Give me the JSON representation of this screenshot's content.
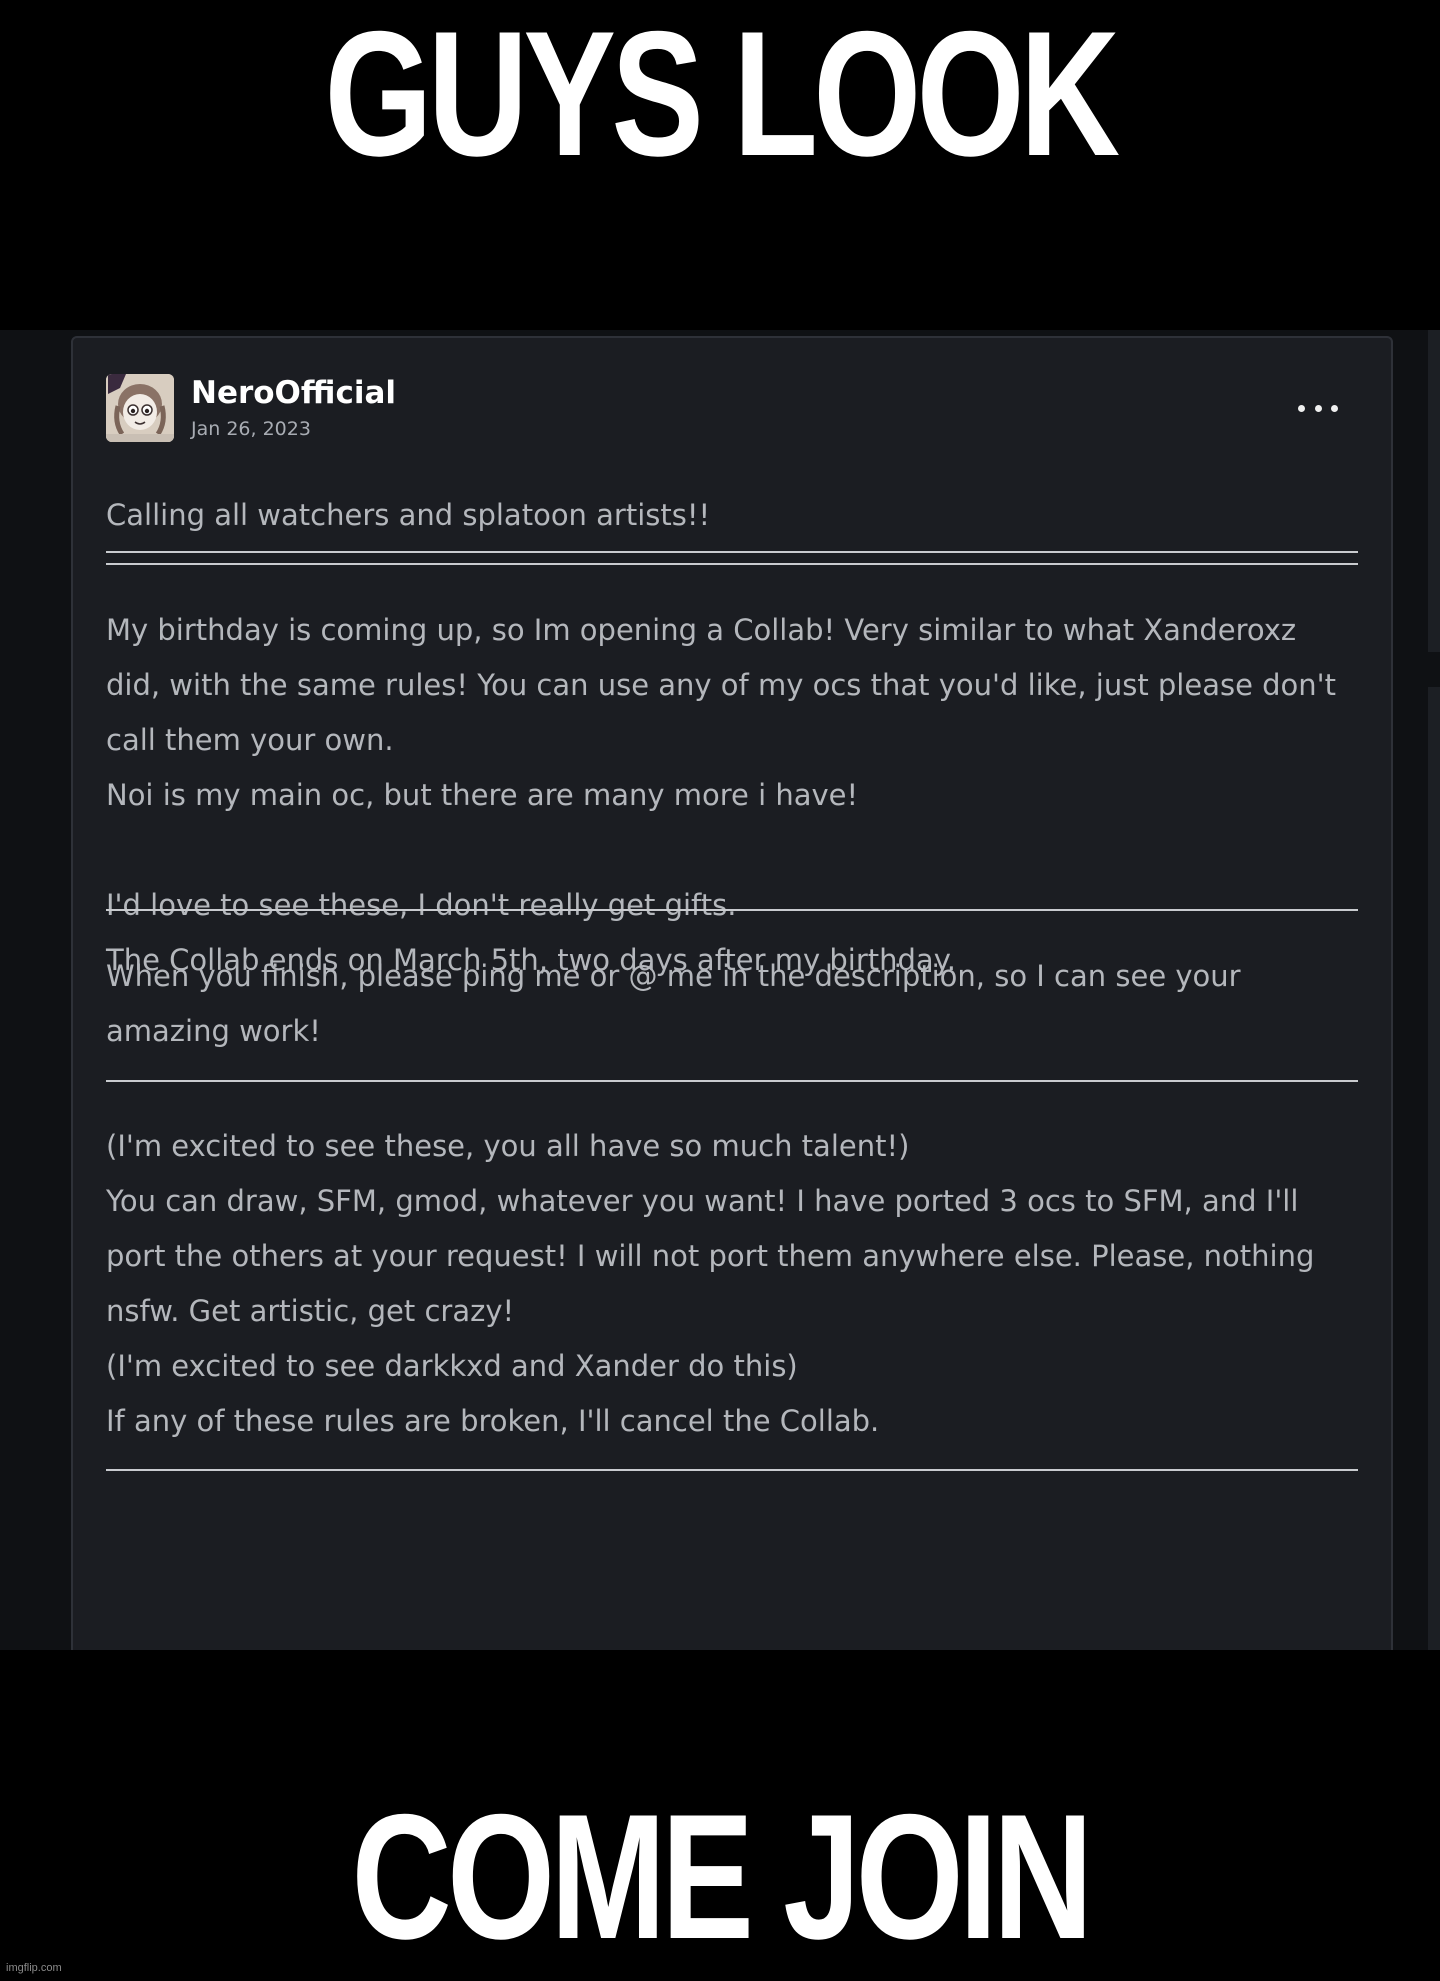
{
  "meme": {
    "top_caption": "GUYS LOOK",
    "bottom_caption": "COME JOIN",
    "watermark": "imgflip.com"
  },
  "post": {
    "author": "NeroOfficial",
    "date": "Jan 26, 2023",
    "avatar_icon": "avatar-image",
    "more_icon": "more-options-icon",
    "intro": "Calling all watchers and splatoon artists!!",
    "section_1": "My birthday is coming up, so Im opening a Collab! Very similar to what Xanderoxz did, with the same rules! You can use any of my ocs that you'd like, just please don't call them your own.\nNoi is my main oc, but there are many more i have!\n\nI'd love to see these, I don't really get gifts.\nThe Collab ends on March 5th, two days after my birthday.",
    "section_2": "When you finish, please ping me or @ me in the description, so I can see your amazing work!",
    "section_3": "(I'm excited to see these, you all have so much talent!)\nYou can draw, SFM, gmod, whatever you want! I have ported 3 ocs to SFM, and I'll port the others at your request! I will not port them anywhere else. Please, nothing nsfw. Get artistic, get crazy!\n(I'm excited to see darkkxd and Xander do this)\nIf any of these rules are broken, I'll cancel the Collab."
  },
  "colors": {
    "background": "#000000",
    "card": "#1b1d22",
    "text": "#b4b7bc",
    "author": "#ffffff"
  }
}
